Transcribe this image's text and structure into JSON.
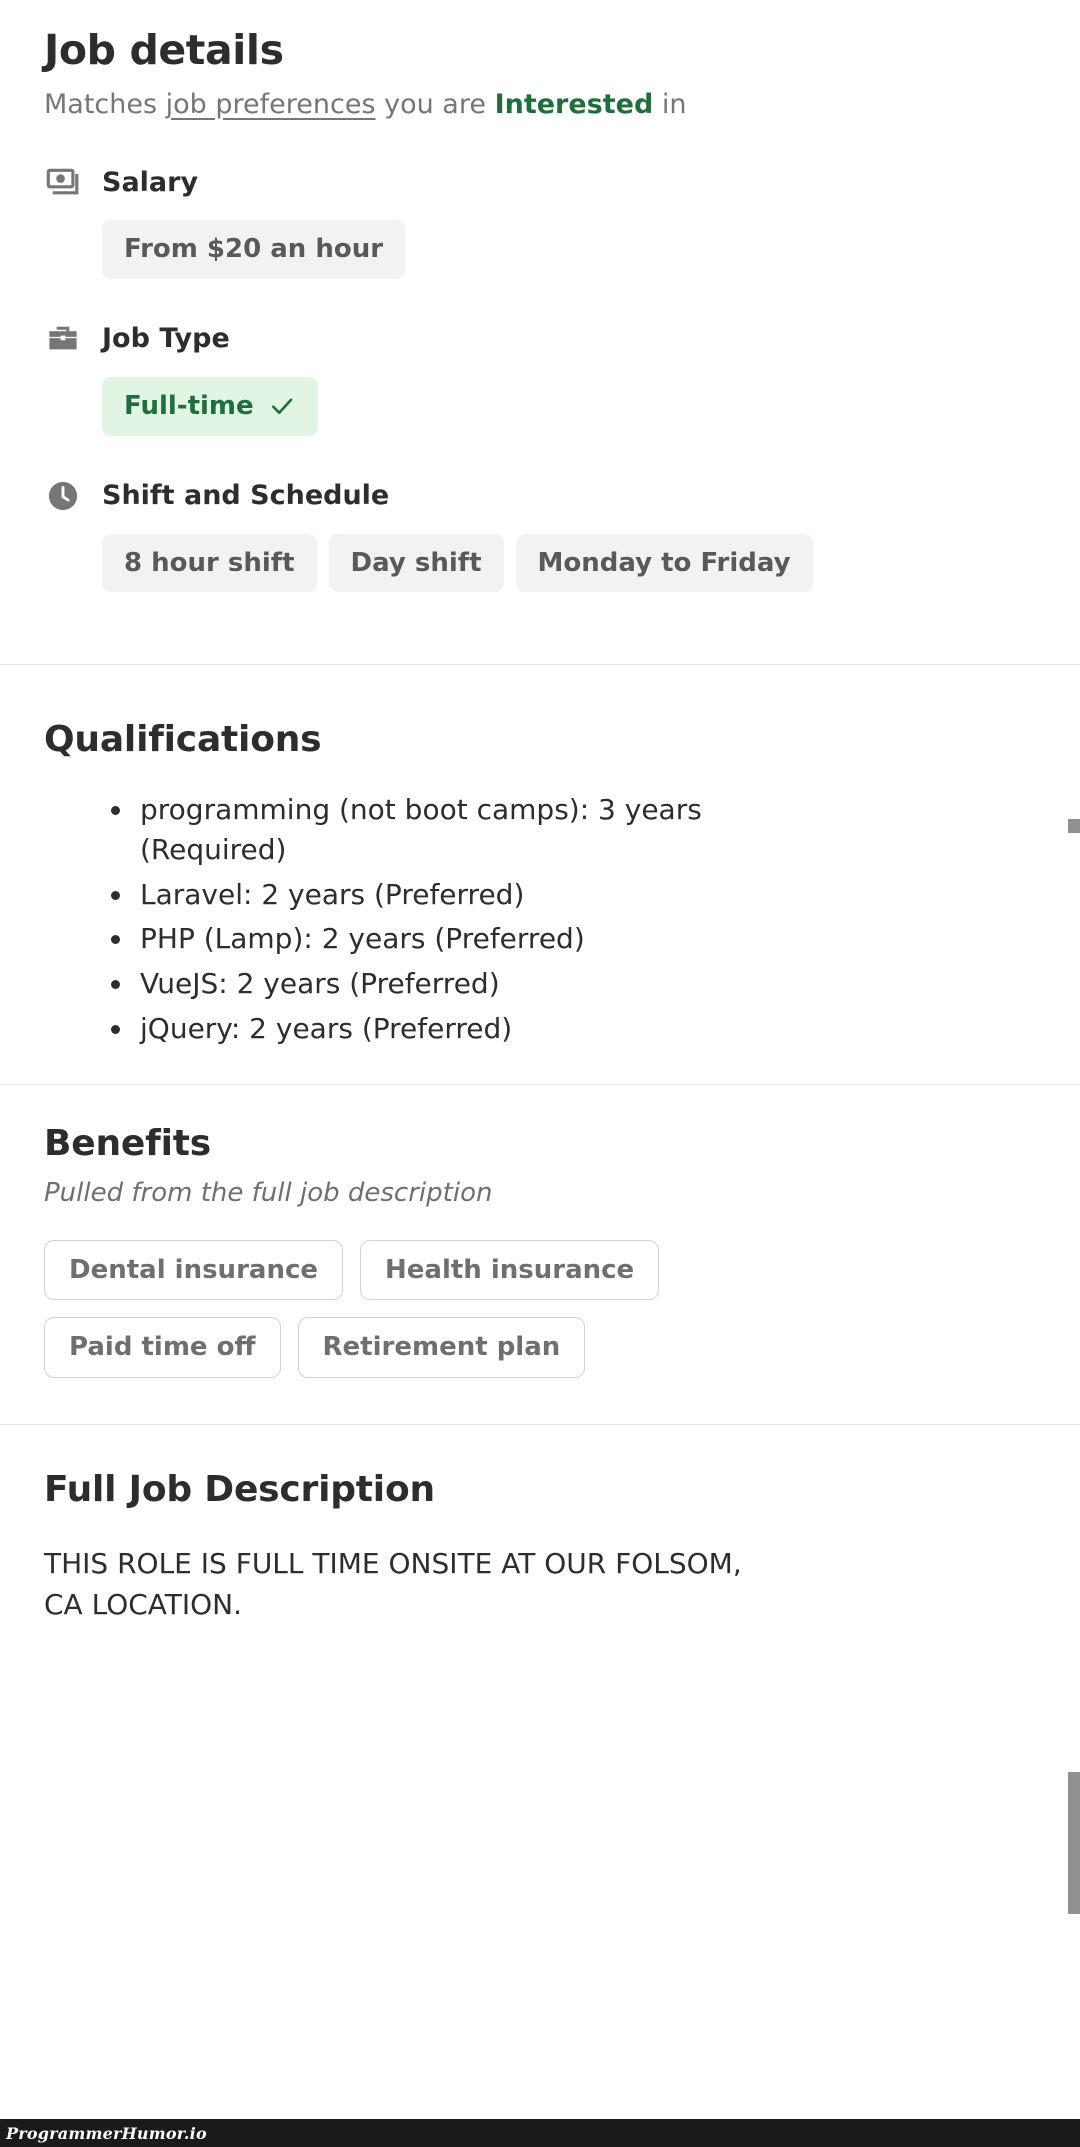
{
  "header": {
    "title": "Job details",
    "matches_prefix": "Matches ",
    "matches_link": "job preferences",
    "matches_middle": " you are ",
    "matches_strong": "Interested",
    "matches_suffix": " in",
    "accent_green": "#1f6e3c"
  },
  "attributes": [
    {
      "icon": "money-icon",
      "label": "Salary",
      "chips": [
        {
          "text": "From $20 an hour",
          "style": "gray",
          "checked": false
        }
      ]
    },
    {
      "icon": "briefcase-icon",
      "label": "Job Type",
      "chips": [
        {
          "text": "Full-time",
          "style": "green",
          "checked": true
        }
      ]
    },
    {
      "icon": "clock-icon",
      "label": "Shift and Schedule",
      "chips": [
        {
          "text": "8 hour shift",
          "style": "gray",
          "checked": false
        },
        {
          "text": "Day shift",
          "style": "gray",
          "checked": false
        },
        {
          "text": "Monday to Friday",
          "style": "gray",
          "checked": false
        }
      ]
    }
  ],
  "qualifications": {
    "title": "Qualifications",
    "items": [
      "programming (not boot camps): 3 years (Required)",
      "Laravel: 2 years (Preferred)",
      "PHP (Lamp): 2 years (Preferred)",
      "VueJS: 2 years (Preferred)",
      "jQuery: 2 years (Preferred)"
    ]
  },
  "benefits": {
    "title": "Benefits",
    "subtitle": "Pulled from the full job description",
    "items": [
      "Dental insurance",
      "Health insurance",
      "Paid time off",
      "Retirement plan"
    ]
  },
  "full_job_description": {
    "title": "Full Job Description",
    "body": "THIS ROLE IS FULL TIME ONSITE AT OUR FOLSOM, CA LOCATION."
  },
  "watermark": {
    "text": "ProgrammerHumor.io"
  }
}
